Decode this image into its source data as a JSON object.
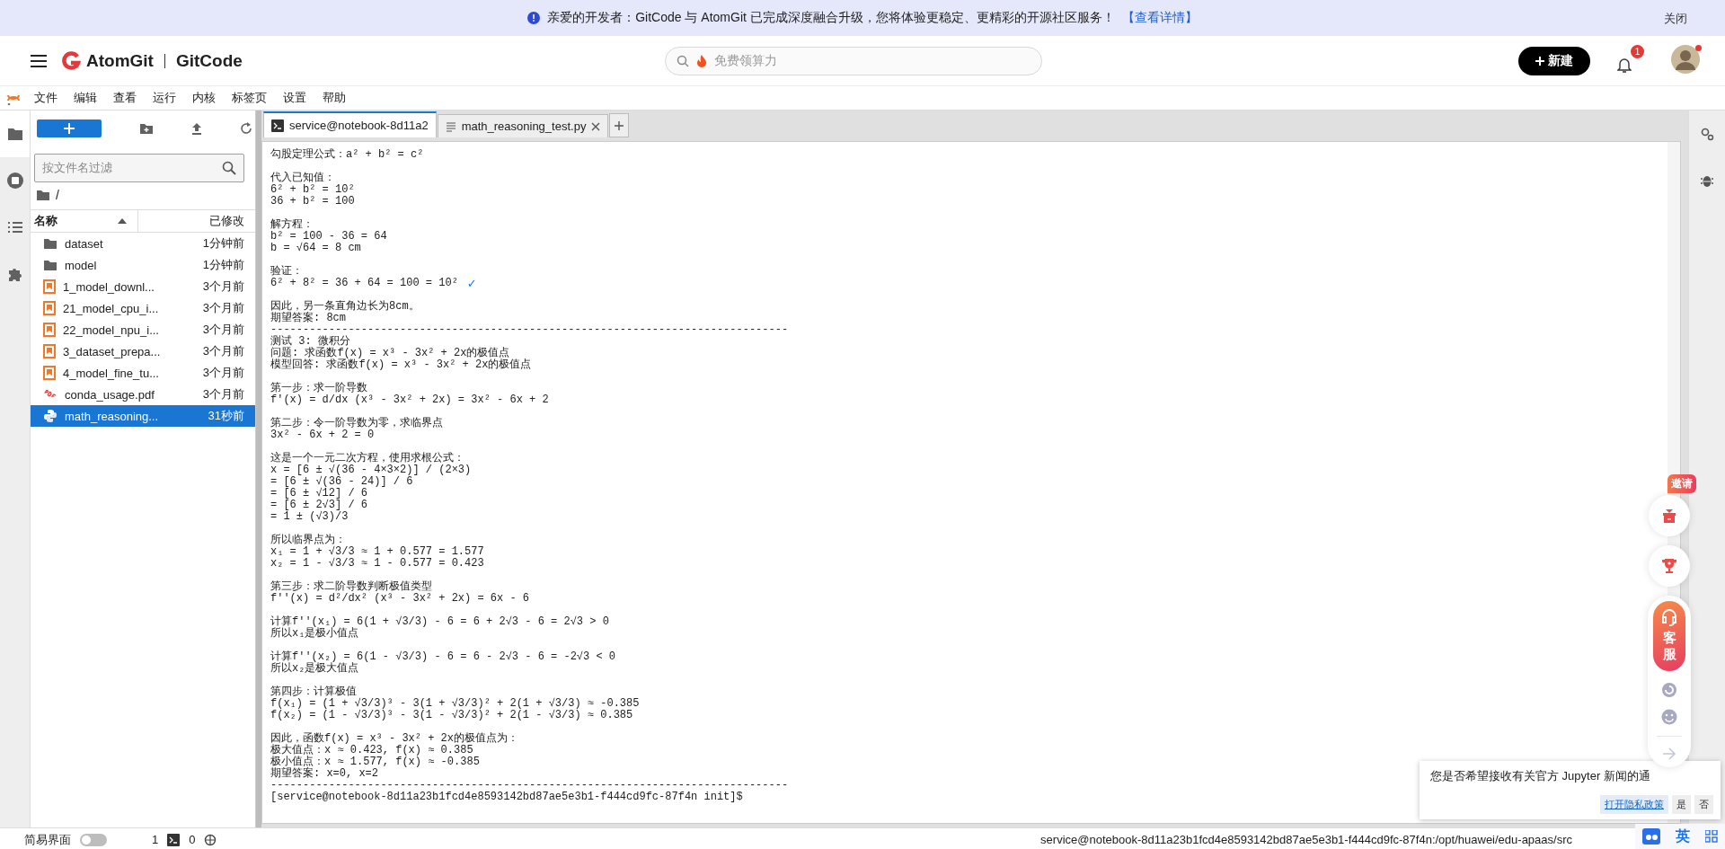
{
  "announcement": {
    "text": "亲爱的开发者：GitCode 与 AtomGit 已完成深度融合升级，您将体验更稳定、更精彩的开源社区服务！",
    "link": "【查看详情】",
    "close": "关闭"
  },
  "header": {
    "brand": "AtomGit",
    "brand2": "GitCode",
    "search_placeholder": "免费领算力",
    "new_button": "新建",
    "notification_count": "1"
  },
  "menu": [
    "文件",
    "编辑",
    "查看",
    "运行",
    "内核",
    "标签页",
    "设置",
    "帮助"
  ],
  "activity_bar": [
    {
      "kind": "folder",
      "selected": true
    },
    {
      "kind": "stop",
      "selected": false
    },
    {
      "kind": "list",
      "selected": false
    },
    {
      "kind": "puzzle",
      "selected": false
    }
  ],
  "file_browser": {
    "filter_placeholder": "按文件名过滤",
    "path": "/",
    "columns": [
      "名称",
      "已修改"
    ],
    "files": [
      {
        "kind": "folder",
        "name": "dataset",
        "modified": "1分钟前",
        "selected": false
      },
      {
        "kind": "folder",
        "name": "model",
        "modified": "1分钟前",
        "selected": false
      },
      {
        "kind": "notebook",
        "name": "1_model_downl...",
        "modified": "3个月前",
        "selected": false
      },
      {
        "kind": "notebook",
        "name": "21_model_cpu_i...",
        "modified": "3个月前",
        "selected": false
      },
      {
        "kind": "notebook",
        "name": "22_model_npu_i...",
        "modified": "3个月前",
        "selected": false
      },
      {
        "kind": "notebook",
        "name": "3_dataset_prepa...",
        "modified": "3个月前",
        "selected": false
      },
      {
        "kind": "notebook",
        "name": "4_model_fine_tu...",
        "modified": "3个月前",
        "selected": false
      },
      {
        "kind": "pdf",
        "name": "conda_usage.pdf",
        "modified": "3个月前",
        "selected": false
      },
      {
        "kind": "python",
        "name": "math_reasoning...",
        "modified": "31秒前",
        "selected": true
      }
    ]
  },
  "tabs": [
    {
      "kind": "terminal",
      "label": "service@notebook-8d11a2",
      "selected": true,
      "closable": false
    },
    {
      "kind": "python",
      "label": "math_reasoning_test.py",
      "selected": false,
      "closable": true
    }
  ],
  "terminal": {
    "blocks": [
      [
        "勾股定理公式：a² + b² = c²"
      ],
      [
        "代入已知值：",
        "6² + b² = 10²",
        "36 + b² = 100"
      ],
      [
        "解方程：",
        "b² = 100 - 36 = 64",
        "b = √64 = 8 cm"
      ],
      [
        "验证：",
        {
          "text": "6² + 8² = 36 + 64 = 100 = 10²",
          "check": "✓"
        }
      ],
      [
        "因此，另一条直角边长为8cm。",
        "期望答案: 8cm",
        "--------------------------------------------------------------------------------",
        "测试 3: 微积分",
        "问题: 求函数f(x) = x³ - 3x² + 2x的极值点",
        "模型回答: 求函数f(x) = x³ - 3x² + 2x的极值点"
      ],
      [
        "第一步：求一阶导数",
        "f'(x) = d/dx (x³ - 3x² + 2x) = 3x² - 6x + 2"
      ],
      [
        "第二步：令一阶导数为零，求临界点",
        "3x² - 6x + 2 = 0"
      ],
      [
        "这是一个一元二次方程，使用求根公式：",
        "x = [6 ± √(36 - 4×3×2)] / (2×3)",
        "= [6 ± √(36 - 24)] / 6",
        "= [6 ± √12] / 6",
        "= [6 ± 2√3] / 6",
        "= 1 ± (√3)/3"
      ],
      [
        "所以临界点为：",
        "x₁ = 1 + √3/3 ≈ 1 + 0.577 = 1.577",
        "x₂ = 1 - √3/3 ≈ 1 - 0.577 = 0.423"
      ],
      [
        "第三步：求二阶导数判断极值类型",
        "f''(x) = d²/dx² (x³ - 3x² + 2x) = 6x - 6"
      ],
      [
        "计算f''(x₁) = 6(1 + √3/3) - 6 = 6 + 2√3 - 6 = 2√3 > 0",
        "所以x₁是极小值点"
      ],
      [
        "计算f''(x₂) = 6(1 - √3/3) - 6 = 6 - 2√3 - 6 = -2√3 < 0",
        "所以x₂是极大值点"
      ],
      [
        "第四步：计算极值",
        "f(x₁) = (1 + √3/3)³ - 3(1 + √3/3)² + 2(1 + √3/3) ≈ -0.385",
        "f(x₂) = (1 - √3/3)³ - 3(1 - √3/3)² + 2(1 - √3/3) ≈ 0.385"
      ],
      [
        "因此，函数f(x) = x³ - 3x² + 2x的极值点为：",
        "极大值点：x ≈ 0.423, f(x) ≈ 0.385",
        "极小值点：x ≈ 1.577, f(x) ≈ -0.385",
        "期望答案: x=0, x=2",
        "--------------------------------------------------------------------------------",
        "[service@notebook-8d11a23b1fcd4e8593142bd87ae5e3b1-f444cd9fc-87f4n init]$"
      ]
    ]
  },
  "status_bar": {
    "simple_mode_label": "简易界面",
    "simple_mode_on": false,
    "terminals": "1",
    "kernels": "0",
    "path": "service@notebook-8d11a23b1fcd4e8593142bd87ae5e3b1-f444cd9fc-87f4n:/opt/huawei/edu-apaas/src"
  },
  "float_bar": {
    "invite": "邀请",
    "service": "客服"
  },
  "notification": {
    "text": "您是否希望接收有关官方 Jupyter 新闻的通",
    "buttons": [
      "打开隐私政策",
      "是",
      "否"
    ]
  },
  "ime": {
    "mode": "英"
  }
}
